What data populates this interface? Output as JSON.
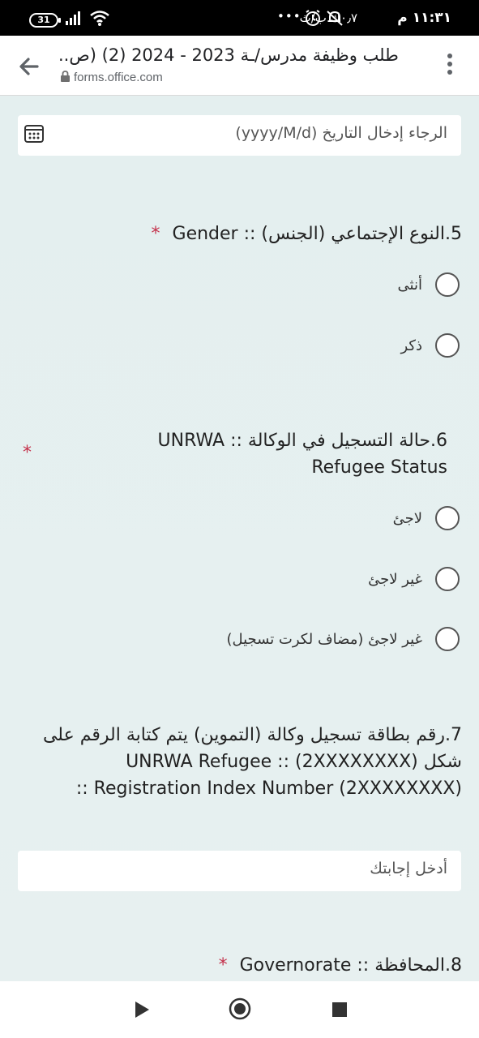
{
  "status_bar": {
    "time": "١١:٣١ م",
    "network_speed": "٠٫٧ك.ب/ث",
    "battery": "31",
    "dots": "•••"
  },
  "browser": {
    "title": "طلب وظيفة مدرس/ـة 2023 - 2024 (2) (ص..",
    "url": "forms.office.com"
  },
  "form": {
    "date_field": {
      "placeholder": "الرجاء إدخال التاريخ (yyyy/M/d)"
    },
    "q5": {
      "number": "5.",
      "text": "النوع الإجتماعي  (الجنس) :: Gender",
      "required": "*",
      "options": [
        "أنثى",
        "ذكر"
      ]
    },
    "q6": {
      "number": "6.",
      "text": "حالة التسجيل في الوكالة :: UNRWA Refugee Status",
      "required": "*",
      "options": [
        "لاجئ",
        "غير لاجئ",
        "غير لاجئ (مضاف لكرت تسجيل)"
      ]
    },
    "q7": {
      "number": "7.",
      "text": "رقم بطاقة تسجيل وكالة (التموين) يتم كتابة الرقم على شكل (2XXXXXXXX) :: UNRWA Refugee Registration Index Number (2XXXXXXXX) ::",
      "answer_placeholder": "أدخل إجابتك"
    },
    "q8": {
      "number": "8.",
      "text": "المحافظة :: Governorate",
      "required": "*"
    }
  },
  "icons": {
    "back": "arrow-left-icon",
    "menu": "more-vert-icon",
    "lock": "lock-icon",
    "calendar": "calendar-icon",
    "nav_back": "play-back-icon",
    "nav_home": "home-circle-icon",
    "nav_recents": "square-icon"
  },
  "colors": {
    "required_star": "#c4314b",
    "page_background": "#e3eeee"
  }
}
